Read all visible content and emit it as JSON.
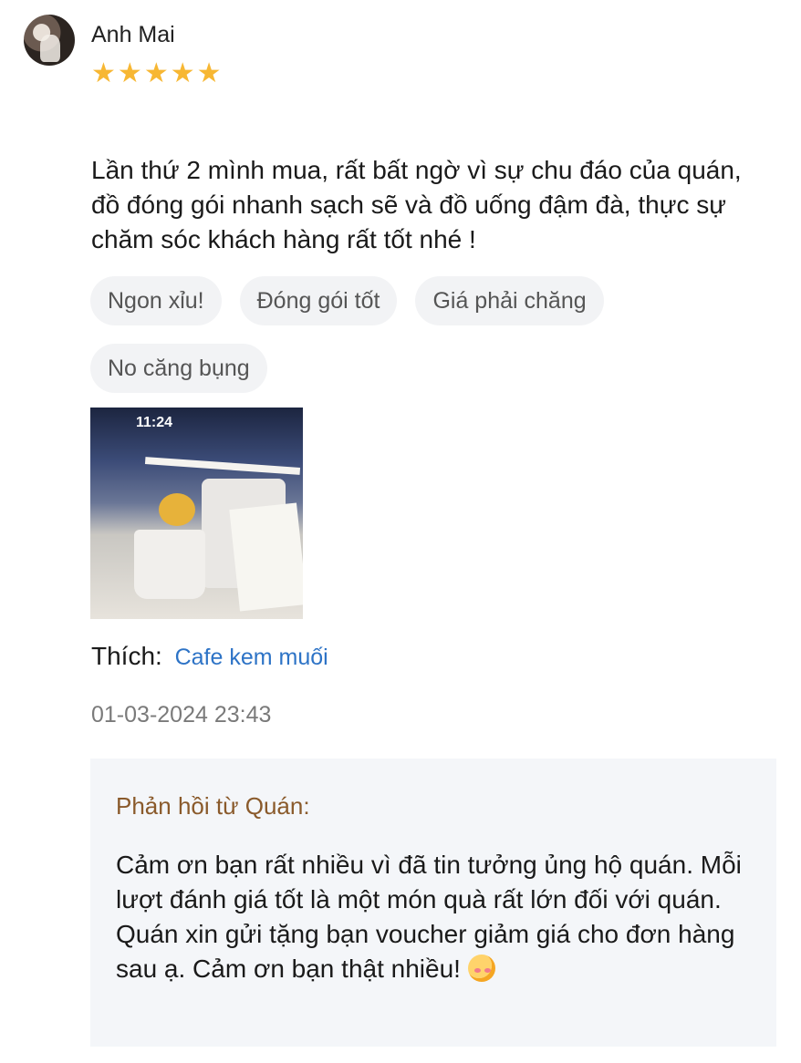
{
  "review": {
    "reviewer_name": "Anh Mai",
    "rating": 5,
    "star_glyph": "★",
    "text": "Lần thứ 2 mình mua, rất bất ngờ vì sự chu đáo của quán, đồ đóng gói nhanh sạch sẽ và đồ uống đậm đà, thực sự chăm sóc khách hàng rất tốt nhé !",
    "tags": [
      "Ngon xỉu!",
      "Đóng gói tốt",
      "Giá phải chăng",
      "No căng bụng"
    ],
    "photo_time": "11:24",
    "like_label": "Thích:",
    "like_item": "Cafe kem muối",
    "date": "01-03-2024 23:43"
  },
  "reply": {
    "title": "Phản hồi từ Quán:",
    "text": "Cảm ơn bạn rất nhiều vì đã tin tưởng ủng hộ quán. Mỗi lượt đánh giá tốt là một món quà rất lớn đối với quán. Quán xin gửi tặng bạn voucher giảm giá cho đơn hàng sau ạ. Cảm ơn bạn thật nhiều!",
    "emoji_icon": "smiling-face-with-hearts-icon"
  },
  "colors": {
    "star": "#f7b733",
    "link": "#2d73c6",
    "reply_title": "#8a5a2b",
    "reply_bg": "#f4f6f9",
    "tag_bg": "#f2f3f5"
  }
}
